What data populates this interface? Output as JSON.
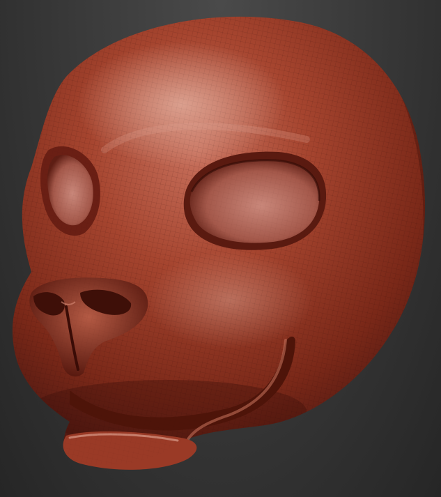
{
  "viewport": {
    "background_top": "#4a4a4a",
    "background_bottom": "#262626"
  },
  "sculpt": {
    "subject": "clay-head-icon",
    "material_base": "#9c3a2a",
    "material_highlight": "#d9a898",
    "material_shadow": "#4a1610",
    "wireframe_visible": true
  }
}
